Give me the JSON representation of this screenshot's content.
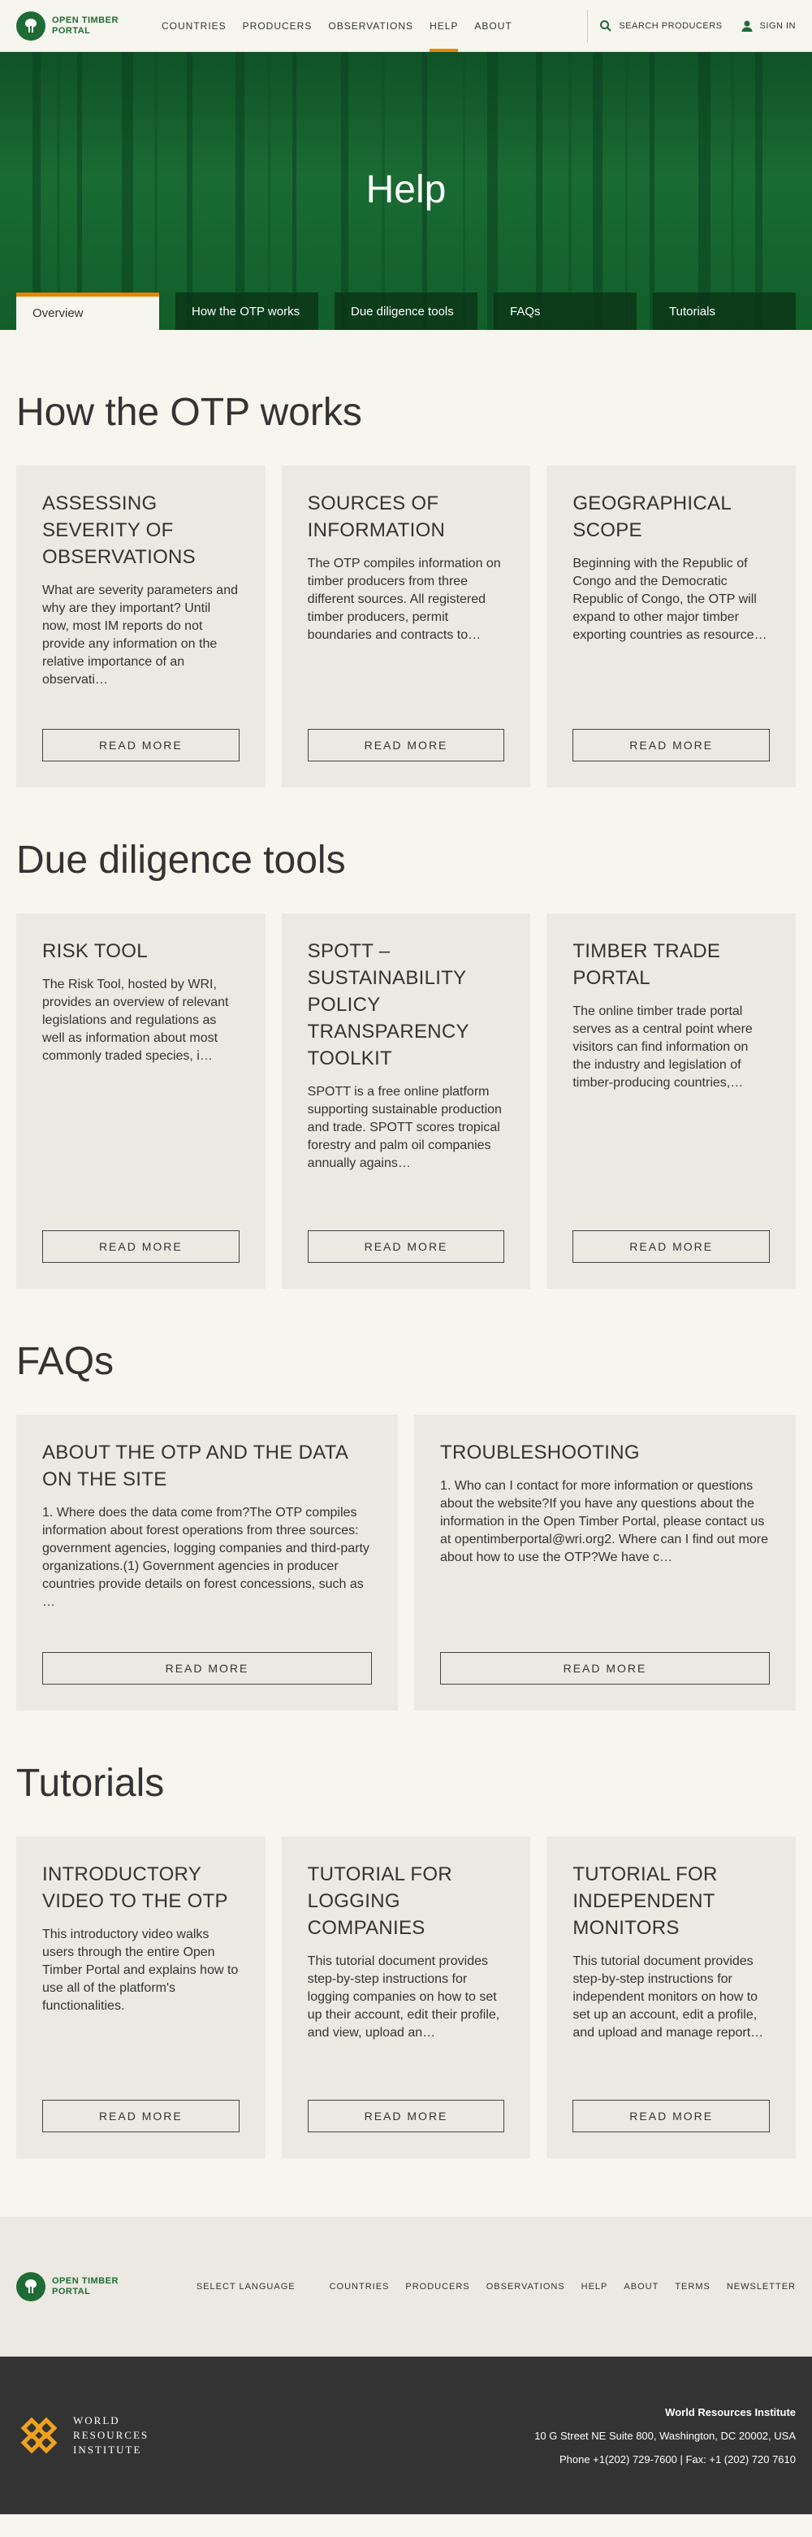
{
  "header": {
    "logo_text": "OPEN TIMBER PORTAL",
    "nav": [
      "COUNTRIES",
      "PRODUCERS",
      "OBSERVATIONS",
      "HELP",
      "ABOUT"
    ],
    "search_label": "SEARCH PRODUCERS",
    "signin_label": "SIGN IN"
  },
  "hero": {
    "title": "Help",
    "tabs": [
      "Overview",
      "How the OTP works",
      "Due diligence tools",
      "FAQs",
      "Tutorials"
    ]
  },
  "sections": {
    "how": {
      "title": "How the OTP works",
      "cards": [
        {
          "title": "ASSESSING SEVERITY OF OBSERVATIONS",
          "text": "What are severity parameters and why are they important? Until now, most IM reports do not provide any information on the relative importance of an observati…",
          "button": "READ MORE"
        },
        {
          "title": "SOURCES OF INFORMATION",
          "text": "The OTP compiles information on timber producers from three different sources. All registered timber producers, permit boundaries and contracts to harvest ar…",
          "button": "READ MORE"
        },
        {
          "title": "GEOGRAPHICAL SCOPE",
          "text": "Beginning with the Republic of Congo and the Democratic Republic of Congo, the OTP will expand to other major timber exporting countries as resources and opportunitie…",
          "button": "READ MORE"
        }
      ]
    },
    "due": {
      "title": "Due diligence tools",
      "cards": [
        {
          "title": "RISK TOOL",
          "text": "The Risk Tool, hosted by WRI, provides an overview of relevant legislations and regulations as well as information about most commonly traded species, i…",
          "button": "READ MORE"
        },
        {
          "title": "SPOTT – SUSTAINABILITY POLICY TRANSPARENCY TOOLKIT",
          "text": "SPOTT is a free online platform supporting sustainable production and trade. SPOTT scores tropical forestry and palm oil companies annually agains…",
          "button": "READ MORE"
        },
        {
          "title": "TIMBER TRADE PORTAL",
          "text": "The online timber trade portal serves as a central point where visitors can find information on the industry and legislation of timber-producing countries,…",
          "button": "READ MORE"
        }
      ]
    },
    "faqs": {
      "title": "FAQs",
      "cards": [
        {
          "title": "ABOUT THE OTP AND THE DATA ON THE SITE",
          "text": "1.    Where does the data come from?The OTP compiles information about forest operations from three sources: government agencies, logging companies and third-party organizations.(1) Government agencies in producer countries provide details on forest concessions, such as …",
          "button": "READ MORE"
        },
        {
          "title": "TROUBLESHOOTING",
          "text": "1.    Who can I contact for more information or questions about the website?If you have any questions about the information in the Open Timber Portal, please contact us at opentimberportal@wri.org2.    Where can I find out more about how to use the OTP?We have c…",
          "button": "READ MORE"
        }
      ]
    },
    "tutorials": {
      "title": "Tutorials",
      "cards": [
        {
          "title": "INTRODUCTORY VIDEO TO THE OTP",
          "text": "This introductory video walks users through the entire Open Timber Portal and explains how to use all of the platform's functionalities.",
          "button": "READ MORE"
        },
        {
          "title": "TUTORIAL FOR LOGGING COMPANIES",
          "text": "This tutorial document provides step-by-step instructions for logging companies on how to set up their account, edit their profile, and view, upload an…",
          "button": "READ MORE"
        },
        {
          "title": "TUTORIAL FOR INDEPENDENT MONITORS",
          "text": "This tutorial document provides step-by-step instructions for independent monitors on how to set up an account, edit a profile, and upload and manage report…",
          "button": "READ MORE"
        }
      ]
    }
  },
  "footer": {
    "logo_text": "OPEN TIMBER PORTAL",
    "select_language": "SELECT LANGUAGE",
    "links": [
      "COUNTRIES",
      "PRODUCERS",
      "OBSERVATIONS",
      "HELP",
      "ABOUT",
      "TERMS",
      "NEWSLETTER"
    ],
    "wri_name": [
      "WORLD",
      "RESOURCES",
      "INSTITUTE"
    ],
    "org": "World Resources Institute",
    "address": "10 G Street NE Suite 800, Washington, DC 20002, USA",
    "phone": "Phone +1(202) 729-7600 | Fax: +1 (202) 720 7610"
  },
  "colors": {
    "brand_green": "#1f6b35",
    "accent_orange": "#e98300",
    "card_bg": "#ebe9e1",
    "page_bg": "#f6f5ee"
  }
}
